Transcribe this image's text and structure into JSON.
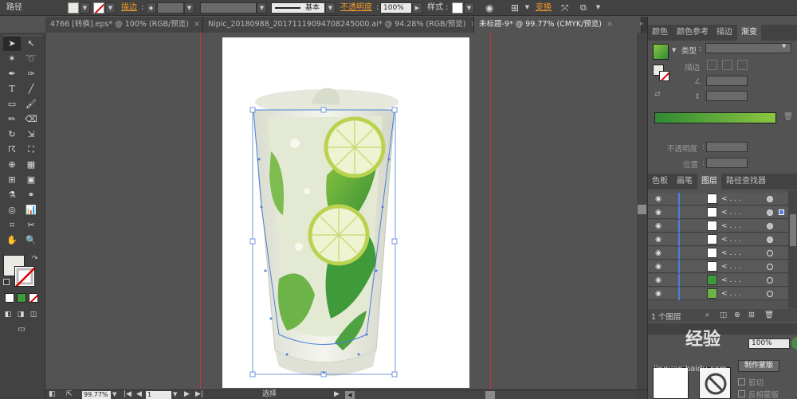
{
  "control_bar": {
    "object_type": "路径",
    "stroke_label": "描边",
    "stroke_style": "基本",
    "opacity_label": "不透明度",
    "opacity_value": "100%",
    "style_label": "样式",
    "transform_label": "变换"
  },
  "tabs": [
    {
      "label": "4766 [转换].eps* @ 100% (RGB/预览)",
      "active": false
    },
    {
      "label": "Nipic_20180988_20171119094708245000.ai* @ 94.28% (RGB/预览)",
      "active": false
    },
    {
      "label": "未标题-9* @ 99.77% (CMYK/预览)",
      "active": true
    }
  ],
  "gradient_panel": {
    "tabs": [
      "颜色",
      "颜色参考",
      "描边",
      "渐变"
    ],
    "type_label": "类型",
    "stroke_label": "描边",
    "opacity_label": "不透明度",
    "position_label": "位置",
    "start_color": "#2f8a35",
    "end_color": "#8cc63f"
  },
  "layers_panel": {
    "tabs": [
      "色板",
      "画笔",
      "图层",
      "路径查找器"
    ],
    "rows": [
      {
        "name": "< . . ."
      },
      {
        "name": "< . . ."
      },
      {
        "name": "< . . ."
      },
      {
        "name": "< . . ."
      },
      {
        "name": "< . . ."
      },
      {
        "name": "< . . ."
      },
      {
        "name": "< . . ."
      },
      {
        "name": "< . . ."
      }
    ],
    "footer_label": "1 个图层"
  },
  "transparency_panel": {
    "opacity_value": "100%",
    "make_mask_button": "制作蒙版",
    "clip_label": "剪切",
    "invert_label": "反相蒙版"
  },
  "status_bar": {
    "zoom": "99.77%",
    "page": "1",
    "mode": "选择"
  },
  "watermark": {
    "text": "经验",
    "url": "jingyan.baidu.com"
  },
  "colors": {
    "fill": "#eaeae4",
    "glass_green": "#3f9a3a",
    "selection": "#4f7fd8",
    "guide": "#c8343a"
  }
}
